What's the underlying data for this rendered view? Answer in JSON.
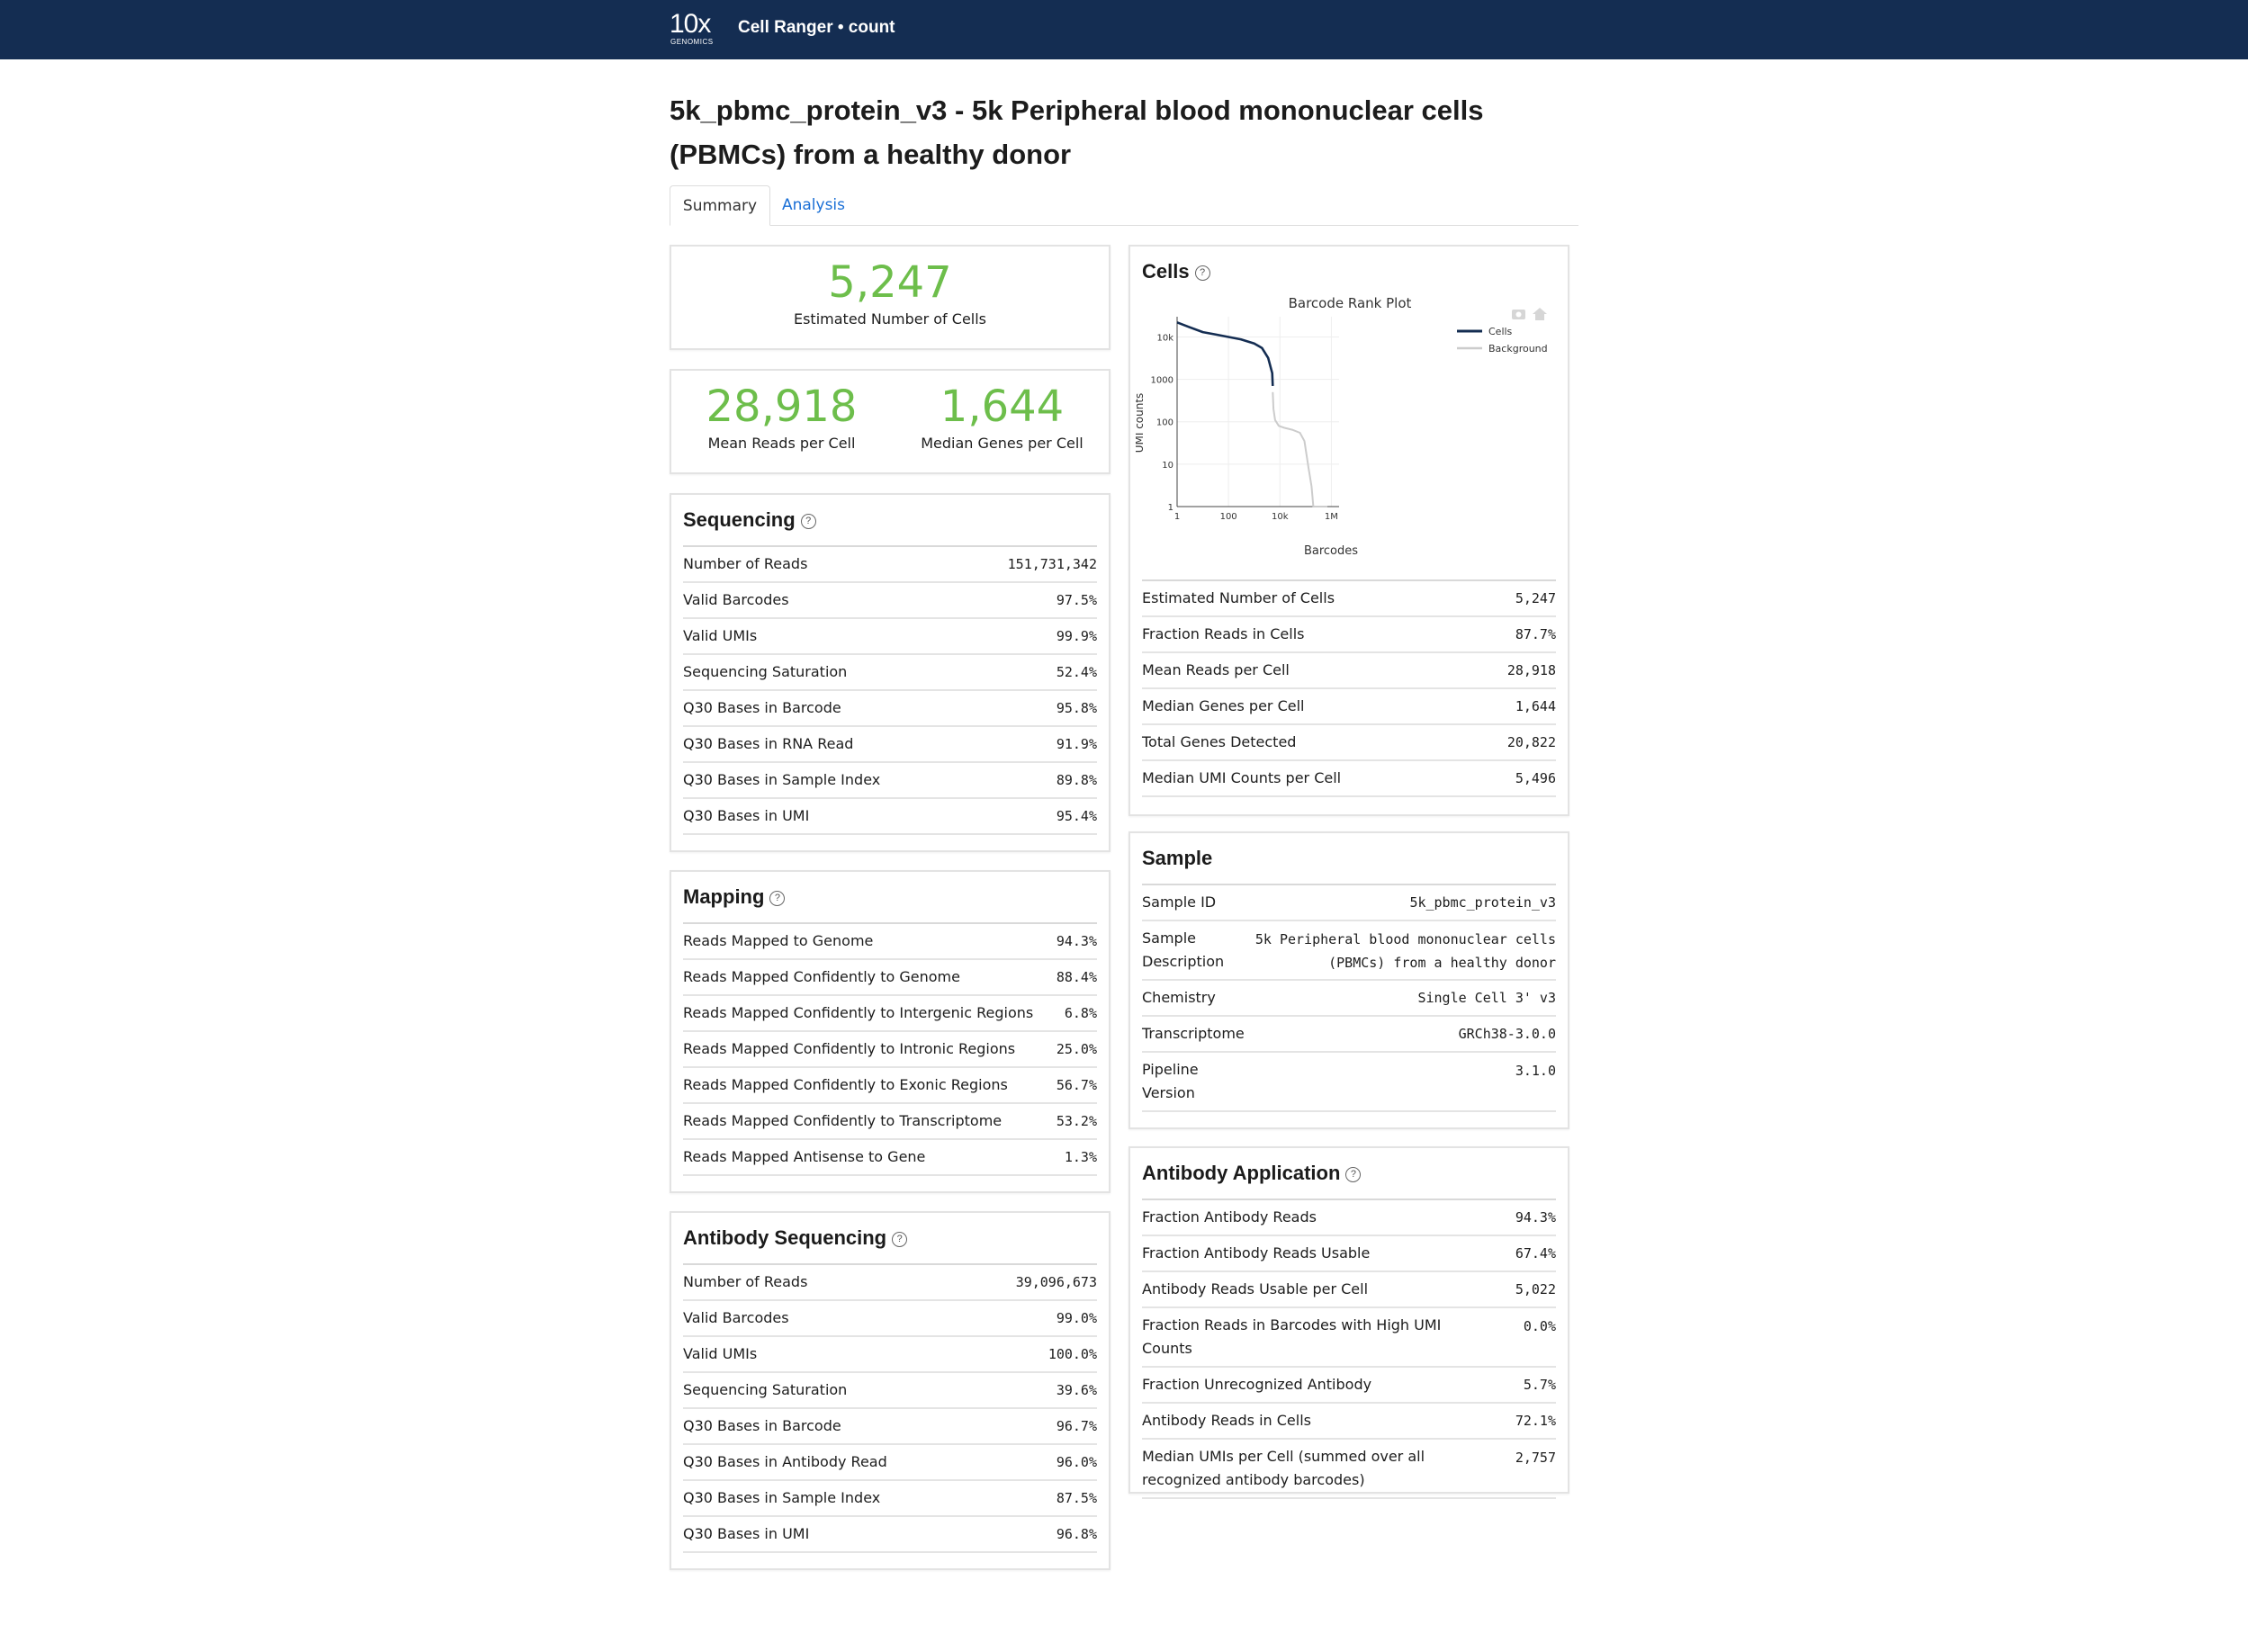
{
  "header": {
    "logo_main": "10x",
    "logo_sub": "GENOMICS",
    "app_title": "Cell Ranger • count"
  },
  "page": {
    "title": "5k_pbmc_protein_v3 - 5k Peripheral blood mononuclear cells (PBMCs) from a healthy donor"
  },
  "tabs": [
    {
      "label": "Summary",
      "active": true
    },
    {
      "label": "Analysis",
      "active": false
    }
  ],
  "summary": {
    "cells_value": "5,247",
    "cells_label": "Estimated Number of Cells",
    "mean_reads_value": "28,918",
    "mean_reads_label": "Mean Reads per Cell",
    "median_genes_value": "1,644",
    "median_genes_label": "Median Genes per Cell"
  },
  "colors": {
    "accent_green": "#6dbe4b",
    "header_navy": "#142d52",
    "link_blue": "#1a6fd6",
    "cells_line": "#142d52",
    "background_line": "#cccccc"
  },
  "sequencing": {
    "title": "Sequencing",
    "rows": [
      {
        "k": "Number of Reads",
        "v": "151,731,342"
      },
      {
        "k": "Valid Barcodes",
        "v": "97.5%"
      },
      {
        "k": "Valid UMIs",
        "v": "99.9%"
      },
      {
        "k": "Sequencing Saturation",
        "v": "52.4%"
      },
      {
        "k": "Q30 Bases in Barcode",
        "v": "95.8%"
      },
      {
        "k": "Q30 Bases in RNA Read",
        "v": "91.9%"
      },
      {
        "k": "Q30 Bases in Sample Index",
        "v": "89.8%"
      },
      {
        "k": "Q30 Bases in UMI",
        "v": "95.4%"
      }
    ]
  },
  "mapping": {
    "title": "Mapping",
    "rows": [
      {
        "k": "Reads Mapped to Genome",
        "v": "94.3%"
      },
      {
        "k": "Reads Mapped Confidently to Genome",
        "v": "88.4%"
      },
      {
        "k": "Reads Mapped Confidently to Intergenic Regions",
        "v": "6.8%"
      },
      {
        "k": "Reads Mapped Confidently to Intronic Regions",
        "v": "25.0%"
      },
      {
        "k": "Reads Mapped Confidently to Exonic Regions",
        "v": "56.7%"
      },
      {
        "k": "Reads Mapped Confidently to Transcriptome",
        "v": "53.2%"
      },
      {
        "k": "Reads Mapped Antisense to Gene",
        "v": "1.3%"
      }
    ]
  },
  "antibody_sequencing": {
    "title": "Antibody Sequencing",
    "rows": [
      {
        "k": "Number of Reads",
        "v": "39,096,673"
      },
      {
        "k": "Valid Barcodes",
        "v": "99.0%"
      },
      {
        "k": "Valid UMIs",
        "v": "100.0%"
      },
      {
        "k": "Sequencing Saturation",
        "v": "39.6%"
      },
      {
        "k": "Q30 Bases in Barcode",
        "v": "96.7%"
      },
      {
        "k": "Q30 Bases in Antibody Read",
        "v": "96.0%"
      },
      {
        "k": "Q30 Bases in Sample Index",
        "v": "87.5%"
      },
      {
        "k": "Q30 Bases in UMI",
        "v": "96.8%"
      }
    ]
  },
  "cells": {
    "title": "Cells",
    "rows": [
      {
        "k": "Estimated Number of Cells",
        "v": "5,247"
      },
      {
        "k": "Fraction Reads in Cells",
        "v": "87.7%"
      },
      {
        "k": "Mean Reads per Cell",
        "v": "28,918"
      },
      {
        "k": "Median Genes per Cell",
        "v": "1,644"
      },
      {
        "k": "Total Genes Detected",
        "v": "20,822"
      },
      {
        "k": "Median UMI Counts per Cell",
        "v": "5,496"
      }
    ]
  },
  "sample": {
    "title": "Sample",
    "rows": [
      {
        "k": "Sample ID",
        "v": "5k_pbmc_protein_v3"
      },
      {
        "k": "Sample Description",
        "v": "5k Peripheral blood mononuclear cells (PBMCs) from a healthy donor"
      },
      {
        "k": "Chemistry",
        "v": "Single Cell 3' v3"
      },
      {
        "k": "Transcriptome",
        "v": "GRCh38-3.0.0"
      },
      {
        "k": "Pipeline Version",
        "v": "3.1.0"
      }
    ]
  },
  "antibody_application": {
    "title": "Antibody Application",
    "rows": [
      {
        "k": "Fraction Antibody Reads",
        "v": "94.3%"
      },
      {
        "k": "Fraction Antibody Reads Usable",
        "v": "67.4%"
      },
      {
        "k": "Antibody Reads Usable per Cell",
        "v": "5,022"
      },
      {
        "k": "Fraction Reads in Barcodes with High UMI Counts",
        "v": "0.0%"
      },
      {
        "k": "Fraction Unrecognized Antibody",
        "v": "5.7%"
      },
      {
        "k": "Antibody Reads in Cells",
        "v": "72.1%"
      },
      {
        "k": "Median UMIs per Cell (summed over all recognized antibody barcodes)",
        "v": "2,757"
      }
    ]
  },
  "chart_data": {
    "type": "line",
    "title": "Barcode Rank Plot",
    "xlabel": "Barcodes",
    "ylabel": "UMI counts",
    "x_scale": "log",
    "y_scale": "log",
    "x_ticks": [
      "1",
      "100",
      "10k",
      "1M"
    ],
    "y_ticks": [
      "1",
      "10",
      "100",
      "1000",
      "10k"
    ],
    "xlim": [
      1,
      2000000
    ],
    "ylim": [
      1,
      30000
    ],
    "grid": true,
    "legend_position": "top-right",
    "series": [
      {
        "name": "Cells",
        "x": [
          1,
          3,
          10,
          30,
          100,
          300,
          1000,
          2000,
          3500,
          5000,
          5247
        ],
        "y": [
          22000,
          17000,
          13000,
          11500,
          10000,
          8800,
          7000,
          5500,
          3200,
          1400,
          700
        ]
      },
      {
        "name": "Background",
        "x": [
          5247,
          5600,
          6500,
          9000,
          15000,
          30000,
          60000,
          90000,
          130000,
          170000,
          200000,
          260000,
          280000,
          700000
        ],
        "y": [
          500,
          200,
          110,
          80,
          72,
          65,
          55,
          35,
          8,
          3,
          1,
          1,
          1,
          1
        ]
      }
    ]
  }
}
